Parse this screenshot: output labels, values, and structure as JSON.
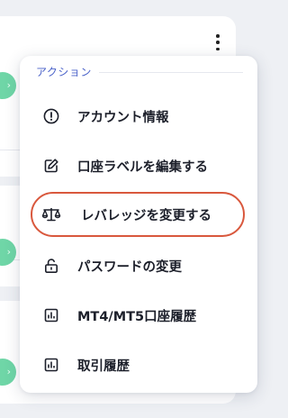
{
  "menu": {
    "header": "アクション",
    "items": [
      {
        "label": "アカウント情報",
        "icon": "info-circle-icon"
      },
      {
        "label": "口座ラベルを編集する",
        "icon": "edit-icon"
      },
      {
        "label": "レバレッジを変更する",
        "icon": "scale-icon",
        "highlighted": true
      },
      {
        "label": "パスワードの変更",
        "icon": "unlock-icon"
      },
      {
        "label": "MT4/MT5口座履歴",
        "icon": "bar-chart-icon"
      },
      {
        "label": "取引履歴",
        "icon": "bar-chart-icon"
      }
    ]
  },
  "colors": {
    "accent": "#4a62c9",
    "highlight_border": "#d9583d",
    "status_dot": "#6fd6a7"
  }
}
